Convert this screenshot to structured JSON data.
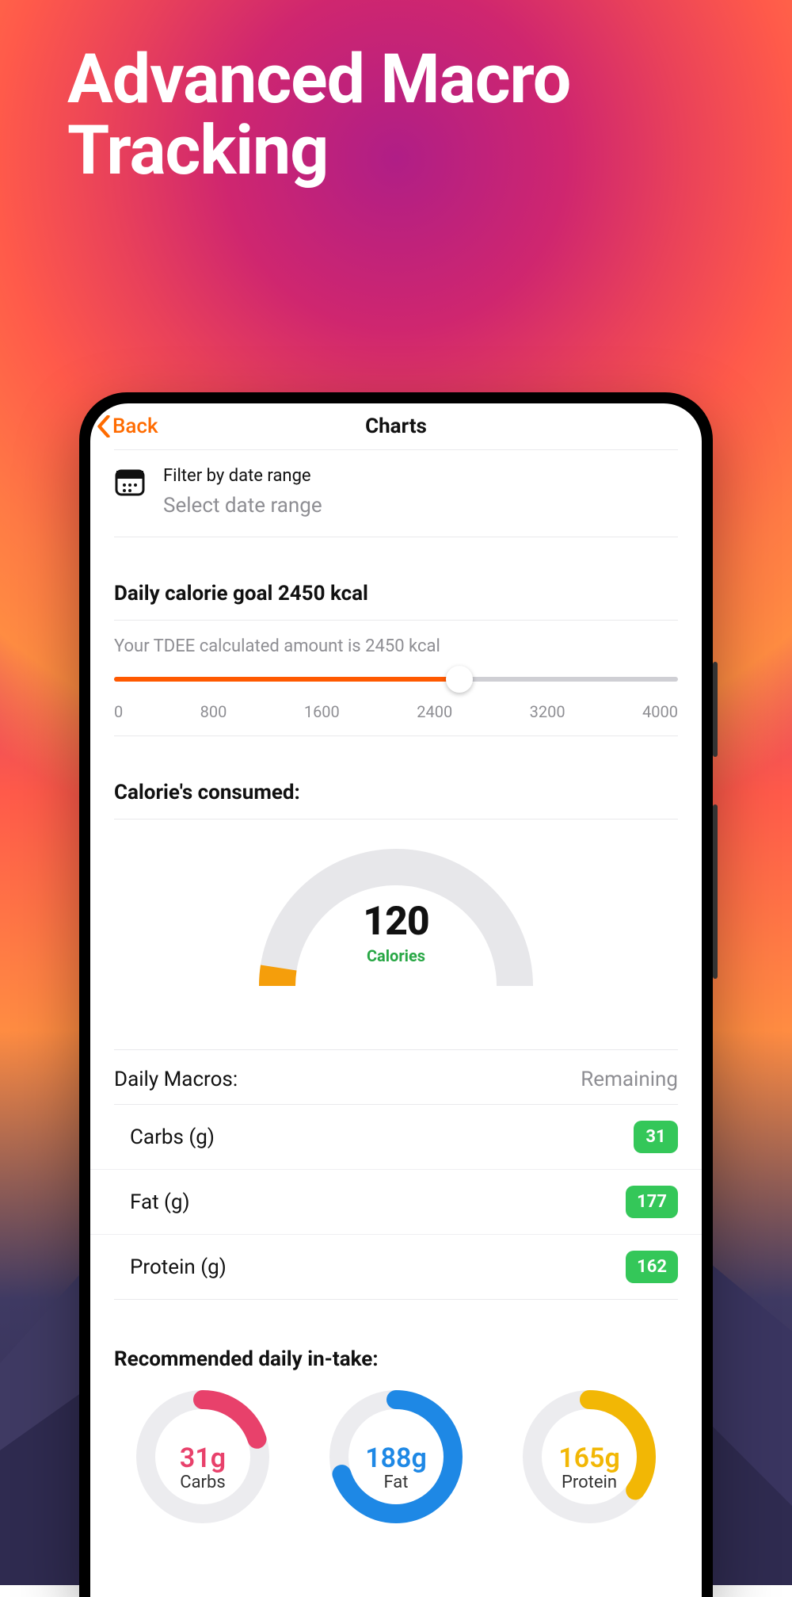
{
  "hero": {
    "line1": "Advanced Macro",
    "line2": "Tracking"
  },
  "nav": {
    "back": "Back",
    "title": "Charts"
  },
  "filter": {
    "label": "Filter by date range",
    "placeholder": "Select date range"
  },
  "goal": {
    "heading": "Daily calorie goal 2450 kcal",
    "tdee": "Your TDEE calculated amount is 2450 kcal",
    "min": 0,
    "max": 4000,
    "value": 2450,
    "ticks": [
      "0",
      "800",
      "1600",
      "2400",
      "3200",
      "4000"
    ]
  },
  "consumed": {
    "heading": "Calorie's consumed:",
    "value": "120",
    "unit": "Calories",
    "fraction": 0.049
  },
  "macros": {
    "heading": "Daily Macros:",
    "remaining_label": "Remaining",
    "rows": [
      {
        "name": "Carbs (g)",
        "remaining": "31"
      },
      {
        "name": "Fat (g)",
        "remaining": "177"
      },
      {
        "name": "Protein (g)",
        "remaining": "162"
      }
    ]
  },
  "recommended": {
    "heading": "Recommended daily in-take:",
    "items": [
      {
        "label": "Carbs",
        "value": "31g",
        "fraction": 0.2,
        "color": "#e8416b"
      },
      {
        "label": "Fat",
        "value": "188g",
        "fraction": 0.7,
        "color": "#1e88e5"
      },
      {
        "label": "Protein",
        "value": "165g",
        "fraction": 0.35,
        "color": "#f2b705"
      }
    ]
  },
  "chart_data": [
    {
      "type": "gauge",
      "title": "Calorie's consumed",
      "value": 120,
      "max": 2450,
      "unit": "Calories"
    },
    {
      "type": "donut",
      "series": [
        {
          "name": "Carbs",
          "value": 31,
          "unit": "g",
          "fraction": 0.2,
          "color": "#e8416b"
        },
        {
          "name": "Fat",
          "value": 188,
          "unit": "g",
          "fraction": 0.7,
          "color": "#1e88e5"
        },
        {
          "name": "Protein",
          "value": 165,
          "unit": "g",
          "fraction": 0.35,
          "color": "#f2b705"
        }
      ]
    }
  ]
}
